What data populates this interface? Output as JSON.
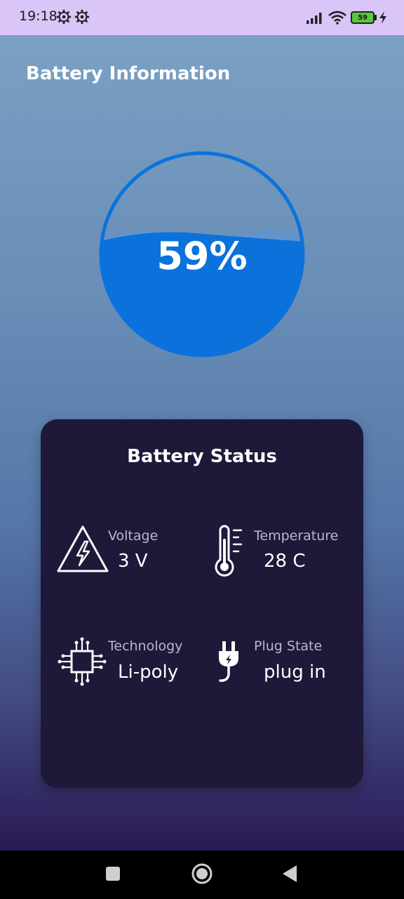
{
  "status_bar": {
    "time": "19:18",
    "battery_level": "59",
    "icons": [
      "gear-icon",
      "gear-icon",
      "signal-icon",
      "wifi-icon",
      "battery-icon",
      "charging-icon"
    ]
  },
  "header": {
    "title": "Battery Information"
  },
  "gauge": {
    "percent_label": "59%",
    "level": 0.59,
    "color": "#0b72db"
  },
  "card": {
    "title": "Battery Status",
    "voltage": {
      "label": "Voltage",
      "value": "3 V",
      "icon": "voltage-warning-icon"
    },
    "temperature": {
      "label": "Temperature",
      "value": "28 C",
      "icon": "thermometer-icon"
    },
    "technology": {
      "label": "Technology",
      "value": "Li-poly",
      "icon": "chip-icon"
    },
    "plug_state": {
      "label": "Plug State",
      "value": "plug in",
      "icon": "plug-icon"
    }
  },
  "nav": {
    "items": [
      "recents-button",
      "home-button",
      "back-button"
    ]
  },
  "colors": {
    "status_bar": "#d9c5f7",
    "card": "#1e1839",
    "accent": "#0b72db"
  }
}
